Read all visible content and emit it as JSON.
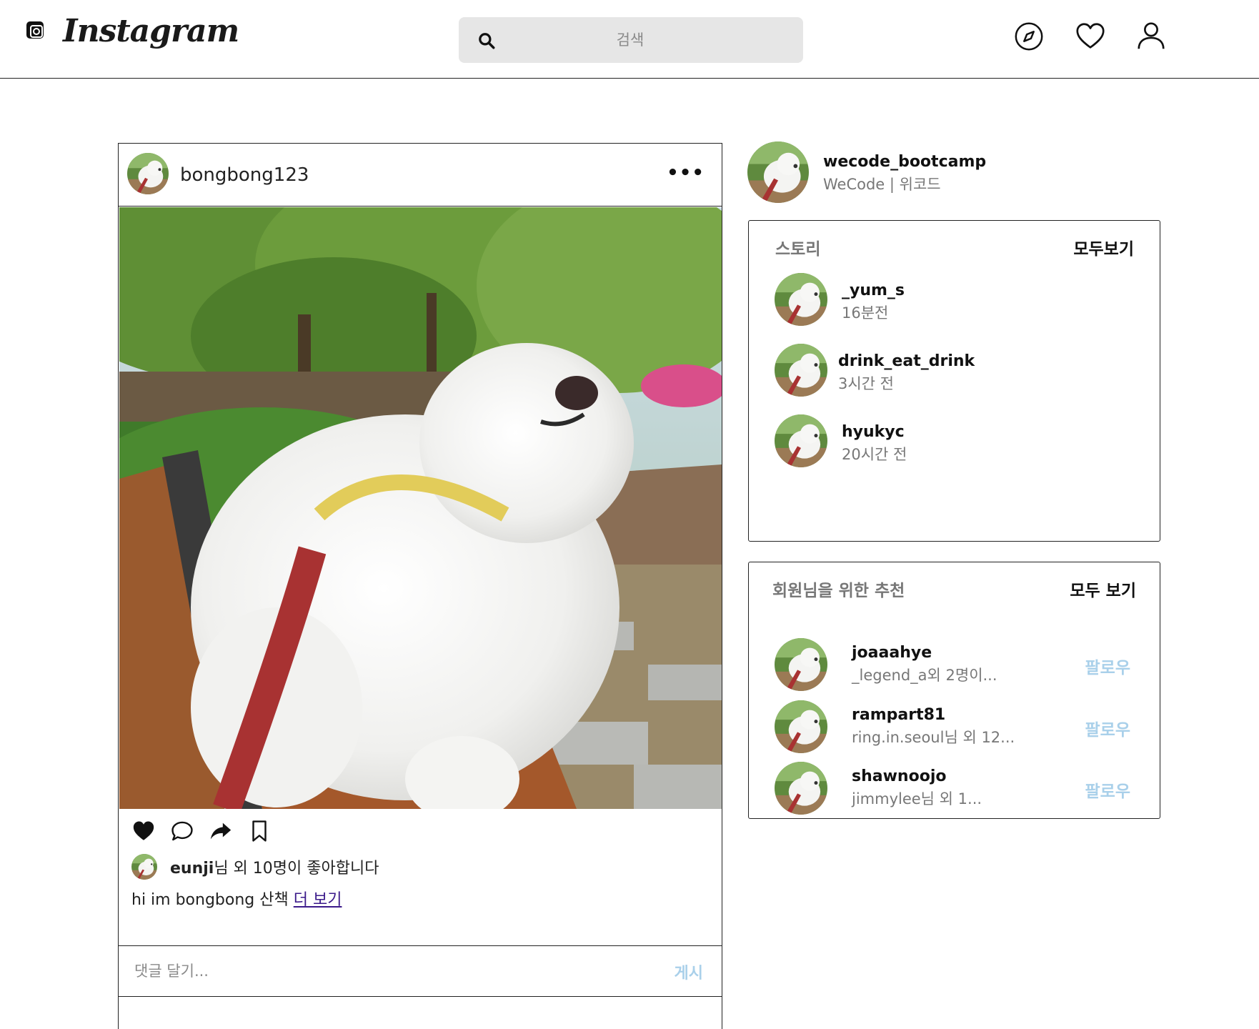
{
  "brand": {
    "name": "Instagram"
  },
  "search": {
    "placeholder": "검색"
  },
  "nav": {
    "icons": [
      "explore-compass-icon",
      "heart-icon",
      "profile-icon"
    ]
  },
  "post": {
    "username": "bongbong123",
    "more_label": "•••",
    "liked_by": "eunji",
    "likes_suffix": "님 외 10명이 좋아합니다",
    "caption": "hi im bongbong 산책",
    "more_link": "더 보기",
    "comment_placeholder": "댓글 달기...",
    "post_button": "게시"
  },
  "me": {
    "username": "wecode_bootcamp",
    "subtitle": "WeCode | 위코드"
  },
  "stories": {
    "title": "스토리",
    "see_all": "모두보기",
    "items": [
      {
        "name": "_yum_s",
        "time": "16분전"
      },
      {
        "name": "drink_eat_drink",
        "time": "3시간 전"
      },
      {
        "name": "hyukyc",
        "time": "20시간 전"
      }
    ]
  },
  "recommendations": {
    "title": "회원님을 위한 추천",
    "see_all": "모두 보기",
    "items": [
      {
        "name": "joaaahye",
        "sub": "_legend_a외 2명이...",
        "follow": "팔로우"
      },
      {
        "name": "rampart81",
        "sub": "ring.in.seoul님 외 12...",
        "follow": "팔로우"
      },
      {
        "name": "shawnoojo",
        "sub": "jimmylee님 외 1...",
        "follow": "팔로우"
      }
    ]
  },
  "colors": {
    "follow": "#a9d0ea",
    "link": "#3b1a8a",
    "muted": "#777777"
  }
}
